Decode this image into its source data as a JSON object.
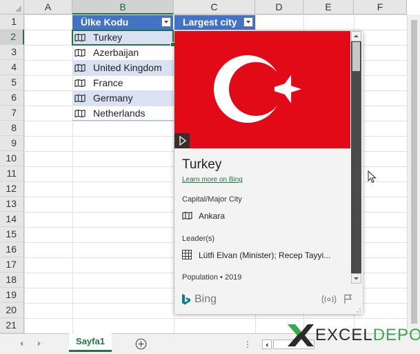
{
  "columns": [
    "A",
    "B",
    "C",
    "D",
    "E",
    "F"
  ],
  "rows": [
    "1",
    "2",
    "3",
    "4",
    "5",
    "6",
    "7",
    "8",
    "9",
    "10",
    "11",
    "12",
    "13",
    "14",
    "15",
    "16",
    "17",
    "18",
    "19",
    "20",
    "21"
  ],
  "selected_column": "B",
  "selected_row": "2",
  "table": {
    "headers": [
      "Ülke Kodu",
      "Largest city"
    ],
    "rows": [
      "Turkey",
      "Azerbaijan",
      "United Kingdom",
      "France",
      "Germany",
      "Netherlands"
    ],
    "row_icon": "map-icon",
    "header_color": "#4472c4",
    "band_color": "#d9e1f2"
  },
  "card": {
    "title": "Turkey",
    "learn_more": "Learn more on Bing",
    "capital_label": "Capital/Major City",
    "capital_value": "Ankara",
    "leader_label": "Leader(s)",
    "leader_value": "Lütfi Elvan (Minister); Recep Tayyi...",
    "population_label": "Population • 2019",
    "provider": "Bing",
    "flag_color": "#e30a17",
    "link_color": "#217346"
  },
  "sheet": {
    "tab_label": "Sayfa1",
    "accent": "#217346"
  },
  "watermark": {
    "x_mark": "X",
    "word1": "EXCEL",
    "word2": "DEPO"
  }
}
